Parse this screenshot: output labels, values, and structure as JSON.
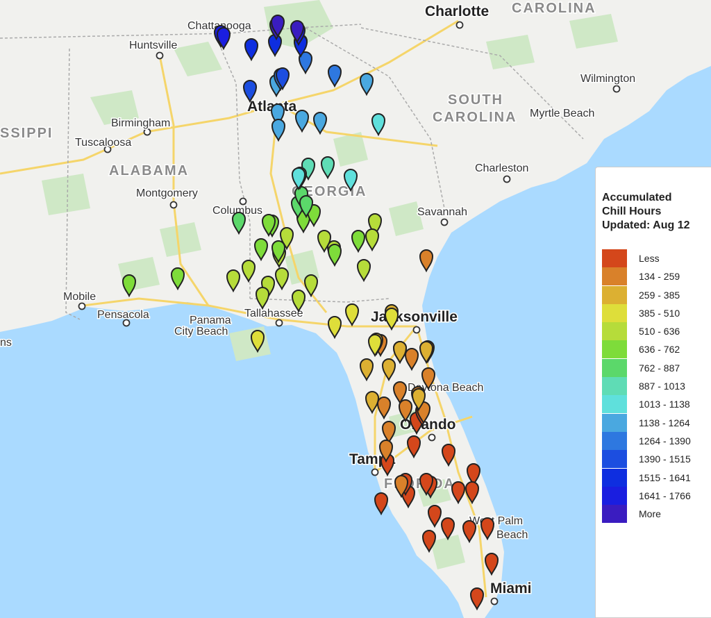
{
  "legend": {
    "title_line1": "Accumulated",
    "title_line2": "Chill Hours",
    "title_line3": "Updated: Aug 12",
    "items": [
      {
        "label": "Less",
        "color": "#d4471b"
      },
      {
        "label": "134 - 259",
        "color": "#d9812a"
      },
      {
        "label": "259 - 385",
        "color": "#dcb032"
      },
      {
        "label": "385 - 510",
        "color": "#dede3a"
      },
      {
        "label": "510 - 636",
        "color": "#b6dc3a"
      },
      {
        "label": "636 - 762",
        "color": "#7edc3a"
      },
      {
        "label": "762 - 887",
        "color": "#5bd86a"
      },
      {
        "label": "887 - 1013",
        "color": "#5fdcb5"
      },
      {
        "label": "1013 - 1138",
        "color": "#5fe0dc"
      },
      {
        "label": "1138 - 1264",
        "color": "#4aa8e0"
      },
      {
        "label": "1264 - 1390",
        "color": "#2e78e0"
      },
      {
        "label": "1390 - 1515",
        "color": "#1c4ee0"
      },
      {
        "label": "1515 - 1641",
        "color": "#0e2ee0"
      },
      {
        "label": "1641 - 1766",
        "color": "#1a1ee0"
      },
      {
        "label": "More",
        "color": "#3a1cc0"
      }
    ]
  },
  "cities": [
    {
      "name": "Charlotte",
      "kind": "big"
    },
    {
      "name": "Chattanooga",
      "kind": "mid"
    },
    {
      "name": "Huntsville",
      "kind": "mid"
    },
    {
      "name": "Wilmington",
      "kind": "mid"
    },
    {
      "name": "Atlanta",
      "kind": "big"
    },
    {
      "name": "Myrtle Beach",
      "kind": "mid"
    },
    {
      "name": "Birmingham",
      "kind": "mid"
    },
    {
      "name": "Tuscaloosa",
      "kind": "mid"
    },
    {
      "name": "Charleston",
      "kind": "mid"
    },
    {
      "name": "Montgomery",
      "kind": "mid"
    },
    {
      "name": "Columbus",
      "kind": "mid"
    },
    {
      "name": "Savannah",
      "kind": "mid"
    },
    {
      "name": "Mobile",
      "kind": "mid"
    },
    {
      "name": "Pensacola",
      "kind": "mid"
    },
    {
      "name": "Panama",
      "kind": "mid"
    },
    {
      "name": "City Beach",
      "kind": "mid"
    },
    {
      "name": "Tallahassee",
      "kind": "mid"
    },
    {
      "name": "Jacksonville",
      "kind": "big"
    },
    {
      "name": "Daytona Beach",
      "kind": "mid"
    },
    {
      "name": "Orlando",
      "kind": "big"
    },
    {
      "name": "Tampa",
      "kind": "big"
    },
    {
      "name": "West Palm",
      "kind": "mid"
    },
    {
      "name": "Beach",
      "kind": "mid"
    },
    {
      "name": "Miami",
      "kind": "big"
    }
  ],
  "regions": [
    "CAROLINA",
    "SOUTH",
    "CAROLINA",
    "SSIPPI",
    "ALABAMA",
    "GEORGIA",
    "FLORIDA"
  ],
  "edge_fragments": [
    "ns"
  ],
  "markers_by_category": {
    "Less": 20,
    "134 - 259": 14,
    "259 - 385": 8,
    "385 - 510": 5,
    "510 - 636": 14,
    "636 - 762": 10,
    "762 - 887": 4,
    "887 - 1013": 3,
    "1013 - 1138": 3,
    "1138 - 1264": 6,
    "1264 - 1390": 4,
    "1390 - 1515": 2,
    "1515 - 1641": 3,
    "1641 - 1766": 3,
    "More": 3
  }
}
